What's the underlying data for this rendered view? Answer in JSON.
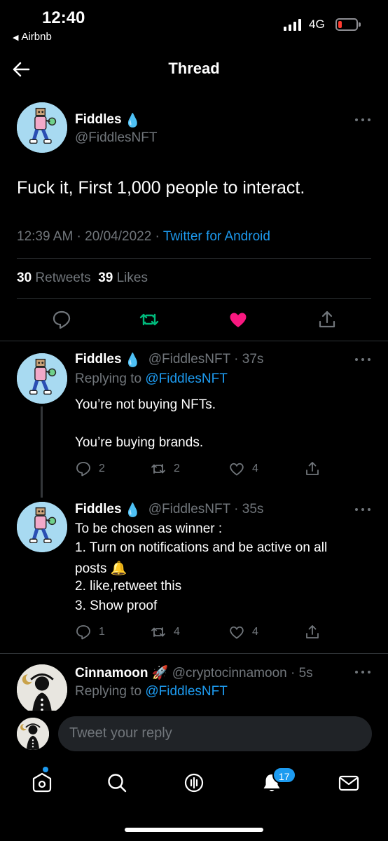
{
  "status_bar": {
    "time": "12:40",
    "back_app": "Airbnb",
    "network": "4G"
  },
  "header": {
    "title": "Thread"
  },
  "main_tweet": {
    "name": "Fiddles",
    "handle": "@FiddlesNFT",
    "text": "Fuck it, First 1,000 people to interact.",
    "time": "12:39 AM",
    "date": "20/04/2022",
    "source": "Twitter for Android",
    "retweets_count": "30",
    "retweets_label": "Retweets",
    "likes_count": "39",
    "likes_label": "Likes",
    "liked": true,
    "like_color": "#f91880",
    "retweet_color": "#00ba7c"
  },
  "replies": [
    {
      "name": "Fiddles",
      "handle": "@FiddlesNFT",
      "time": "37s",
      "replying_label": "Replying to",
      "replying_to": "@FiddlesNFT",
      "lines": [
        "You’re not buying NFTs.",
        "You’re buying brands."
      ],
      "replies": "2",
      "retweets": "2",
      "likes": "4"
    },
    {
      "name": "Fiddles",
      "handle": "@FiddlesNFT",
      "time": "35s",
      "lines": [
        "To be chosen as winner :",
        "1. Turn on notifications and be active on all",
        "posts",
        "2. like,retweet this",
        "3. Show proof"
      ],
      "replies": "1",
      "retweets": "4",
      "likes": "4"
    },
    {
      "name": "Cinnamoon",
      "handle": "@cryptocinnamoon",
      "time": "5s",
      "replying_label": "Replying to",
      "replying_to": "@FiddlesNFT"
    }
  ],
  "composer": {
    "placeholder": "Tweet your reply"
  },
  "tabbar": {
    "items": [
      "home-icon",
      "search-icon",
      "spaces-icon",
      "notifications-icon",
      "messages-icon"
    ],
    "notifications_badge": "17"
  },
  "colors": {
    "accent": "#1d9bf0",
    "background": "#000000",
    "muted": "#71767b",
    "battery_low": "#ff3b30"
  },
  "emoji": {
    "drop": "💧",
    "bell": "🔔",
    "rocket": "🚀"
  }
}
